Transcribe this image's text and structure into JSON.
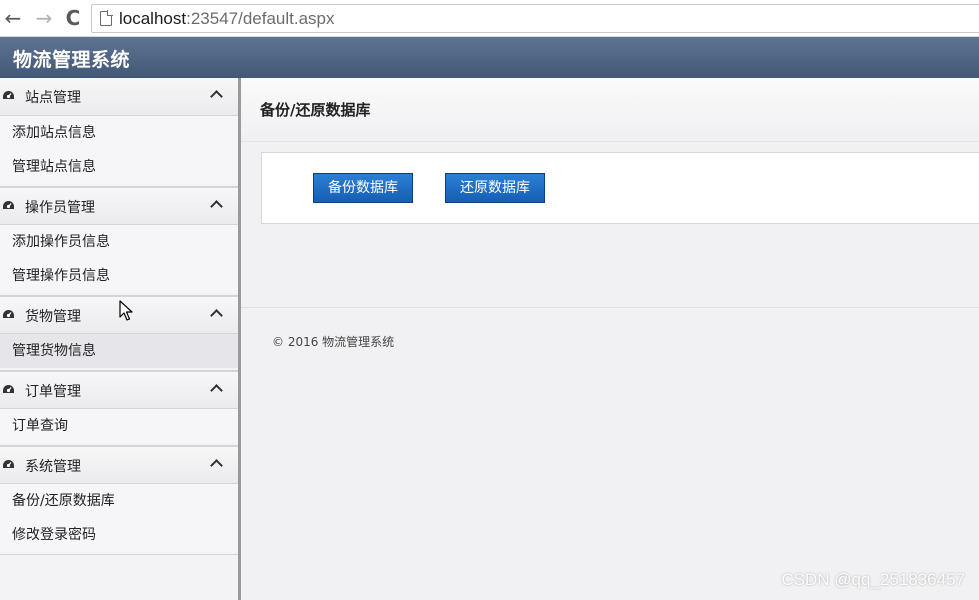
{
  "browser": {
    "url_host": "localhost",
    "url_rest": ":23547/default.aspx",
    "back_icon": "←",
    "forward_icon": "→",
    "reload_icon": "C"
  },
  "app": {
    "title": "物流管理系统"
  },
  "sidebar": {
    "groups": [
      {
        "title": "站点管理",
        "items": [
          "添加站点信息",
          "管理站点信息"
        ]
      },
      {
        "title": "操作员管理",
        "items": [
          "添加操作员信息",
          "管理操作员信息"
        ]
      },
      {
        "title": "货物管理",
        "items": [
          "管理货物信息"
        ]
      },
      {
        "title": "订单管理",
        "items": [
          "订单查询"
        ]
      },
      {
        "title": "系统管理",
        "items": [
          "备份/还原数据库",
          "修改登录密码"
        ]
      }
    ],
    "active_item": "管理货物信息"
  },
  "main": {
    "page_title": "备份/还原数据库",
    "backup_button": "备份数据库",
    "restore_button": "还原数据库",
    "footer": "© 2016 物流管理系统"
  },
  "watermark": "CSDN @qq_251836457",
  "colors": {
    "header": "#4f6483",
    "button": "#1f6fc6"
  }
}
